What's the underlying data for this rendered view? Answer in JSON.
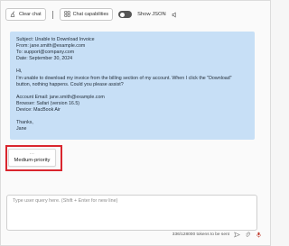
{
  "toolbar": {
    "clear_label": "Clear chat",
    "capabilities_label": "Chat capabilities",
    "json_label": "Show JSON",
    "json_toggle": false
  },
  "message": {
    "lines": [
      "Subject: Unable to Download Invoice",
      "From: jane.smith@example.com",
      "To: support@company.com",
      "Date: September 30, 2024",
      "",
      "Hi,",
      "I'm unable to download my invoice from the billing section of my account. When I click the \"Download\"",
      "button, nothing happens. Could you please assist?",
      "",
      "Account Email: jane.smith@example.com",
      "Browser: Safari (version 16.5)",
      "Device: MacBook Air",
      "",
      "Thanks,",
      "Jane"
    ]
  },
  "response": {
    "dots": "...",
    "label": "Medium-priority"
  },
  "input": {
    "placeholder": "Type user query here. (Shift + Enter for new line)",
    "value": "",
    "token_count": "336/128000 tokens to be sent"
  },
  "colors": {
    "bubble": "#c7dff6",
    "highlight": "#d9262e",
    "accent": "#1a5fb4"
  },
  "icons": [
    "broom-icon",
    "grid-icon",
    "speaker-icon",
    "attach-icon",
    "mic-icon",
    "send-icon"
  ]
}
